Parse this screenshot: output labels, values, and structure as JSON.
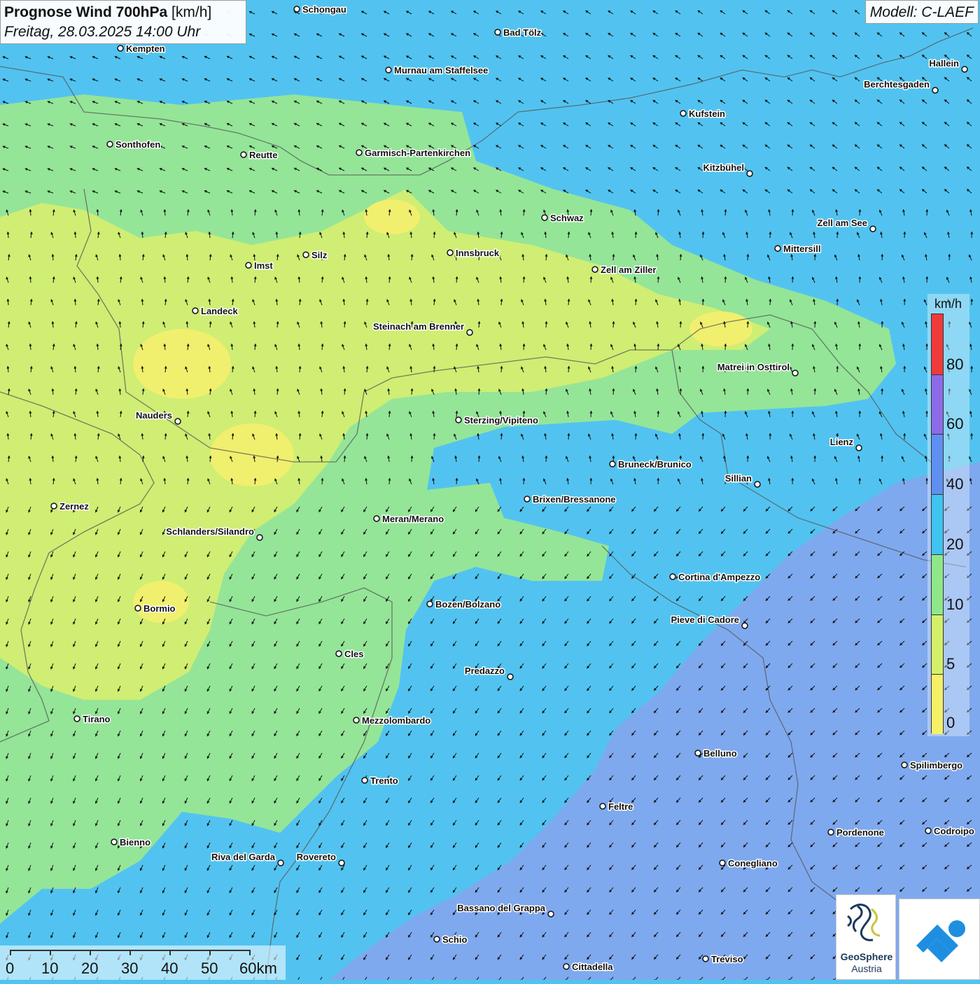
{
  "title": {
    "main": "Prognose Wind 700hPa",
    "unit": "[km/h]",
    "datetime": "Freitag, 28.03.2025 14:00 Uhr"
  },
  "model": "Modell: C-LAEF",
  "legend": {
    "unit": "km/h",
    "labels": [
      "80",
      "60",
      "40",
      "20",
      "10",
      "5",
      "0"
    ],
    "colors": [
      "#f03a3a",
      "#8d6ae8",
      "#5f8ff0",
      "#3fc3f0",
      "#8ee88a",
      "#d4f06a",
      "#f5f066"
    ]
  },
  "scale": {
    "labels": [
      "0",
      "10",
      "20",
      "30",
      "40",
      "50",
      "60km"
    ]
  },
  "logos": {
    "geosphere_line1": "GeoSphere",
    "geosphere_line2": "Austria"
  },
  "cities": [
    {
      "name": "Schongau",
      "side": "right"
    },
    {
      "name": "Bad Tölz",
      "side": "right"
    },
    {
      "name": "Kempten",
      "side": "right"
    },
    {
      "name": "Murnau am Staffelsee",
      "side": "right"
    },
    {
      "name": "Hallein",
      "side": "left"
    },
    {
      "name": "Berchtesgaden",
      "side": "left"
    },
    {
      "name": "Kufstein",
      "side": "right"
    },
    {
      "name": "Sonthofen",
      "side": "right"
    },
    {
      "name": "Reutte",
      "side": "right"
    },
    {
      "name": "Garmisch-Partenkirchen",
      "side": "right"
    },
    {
      "name": "Kitzbühel",
      "side": "left"
    },
    {
      "name": "Schwaz",
      "side": "right"
    },
    {
      "name": "Zell am See",
      "side": "left"
    },
    {
      "name": "Mittersill",
      "side": "right"
    },
    {
      "name": "Silz",
      "side": "right"
    },
    {
      "name": "Innsbruck",
      "side": "right"
    },
    {
      "name": "Imst",
      "side": "right"
    },
    {
      "name": "Zell am Ziller",
      "side": "right"
    },
    {
      "name": "Landeck",
      "side": "right"
    },
    {
      "name": "Steinach am Brenner",
      "side": "left"
    },
    {
      "name": "Matrei in Osttirol",
      "side": "left"
    },
    {
      "name": "Nauders",
      "side": "left"
    },
    {
      "name": "Sterzing/Vipiteno",
      "side": "right"
    },
    {
      "name": "Lienz",
      "side": "left"
    },
    {
      "name": "Bruneck/Brunico",
      "side": "right"
    },
    {
      "name": "Sillian",
      "side": "left"
    },
    {
      "name": "Brixen/Bressanone",
      "side": "right"
    },
    {
      "name": "Zernez",
      "side": "right"
    },
    {
      "name": "Meran/Merano",
      "side": "right"
    },
    {
      "name": "Schlanders/Silandro",
      "side": "left"
    },
    {
      "name": "Cortina d'Ampezzo",
      "side": "right"
    },
    {
      "name": "Bozen/Bolzano",
      "side": "right"
    },
    {
      "name": "Bormio",
      "side": "right"
    },
    {
      "name": "Pieve di Cadore",
      "side": "left"
    },
    {
      "name": "Cles",
      "side": "right"
    },
    {
      "name": "Predazzo",
      "side": "left"
    },
    {
      "name": "Tirano",
      "side": "right"
    },
    {
      "name": "Mezzolombardo",
      "side": "right"
    },
    {
      "name": "Belluno",
      "side": "right"
    },
    {
      "name": "Spilimbergo",
      "side": "right"
    },
    {
      "name": "Trento",
      "side": "right"
    },
    {
      "name": "Feltre",
      "side": "right"
    },
    {
      "name": "Pordenone",
      "side": "right"
    },
    {
      "name": "Codroipo",
      "side": "right"
    },
    {
      "name": "Bienno",
      "side": "right"
    },
    {
      "name": "Riva del Garda",
      "side": "left"
    },
    {
      "name": "Rovereto",
      "side": "left"
    },
    {
      "name": "Conegliano",
      "side": "right"
    },
    {
      "name": "Bassano del Grappa",
      "side": "left"
    },
    {
      "name": "Schio",
      "side": "right"
    },
    {
      "name": "Treviso",
      "side": "right"
    },
    {
      "name": "Cittadella",
      "side": "right"
    }
  ]
}
